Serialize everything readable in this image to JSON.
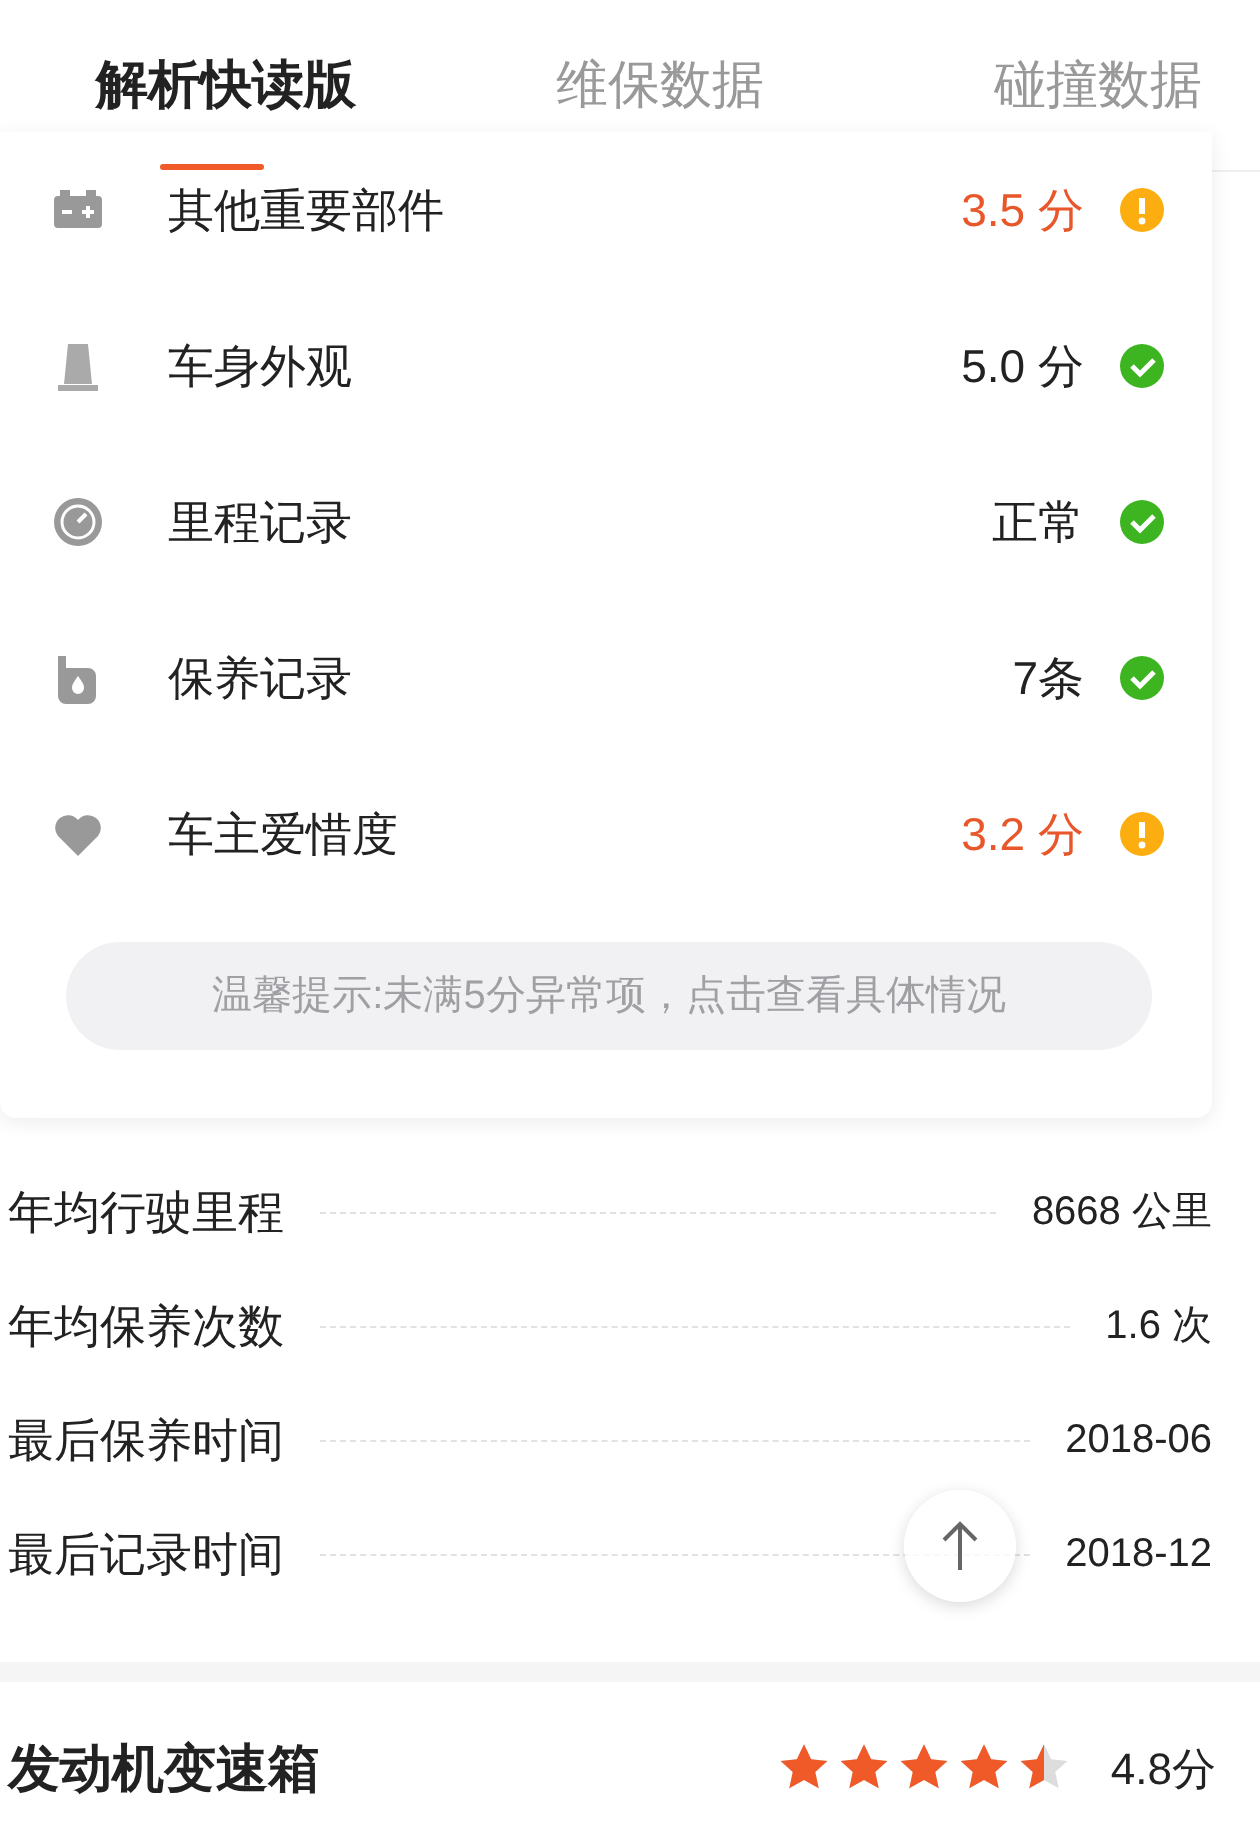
{
  "tabs": [
    {
      "label": "解析快读版",
      "selected": true
    },
    {
      "label": "维保数据",
      "selected": false
    },
    {
      "label": "碰撞数据",
      "selected": false
    }
  ],
  "checks": [
    {
      "kind": "battery",
      "label": "其他重要部件",
      "value": "3.5 分",
      "warning": true
    },
    {
      "kind": "body",
      "label": "车身外观",
      "value": "5.0 分",
      "warning": false
    },
    {
      "kind": "gauge",
      "label": "里程记录",
      "value": "正常",
      "warning": false
    },
    {
      "kind": "oil",
      "label": "保养记录",
      "value": "7条",
      "warning": false
    },
    {
      "kind": "heart",
      "label": "车主爱惜度",
      "value": "3.2 分",
      "warning": true
    }
  ],
  "tip": "温馨提示:未满5分异常项，点击查看具体情况",
  "stats": [
    {
      "label": "年均行驶里程",
      "value": "8668 公里"
    },
    {
      "label": "年均保养次数",
      "value": "1.6 次"
    },
    {
      "label": "最后保养时间",
      "value": "2018-06"
    },
    {
      "label": "最后记录时间",
      "value": "2018-12"
    }
  ],
  "section": {
    "title": "发动机变速箱",
    "stars": 4.5,
    "score": "4.8分"
  }
}
